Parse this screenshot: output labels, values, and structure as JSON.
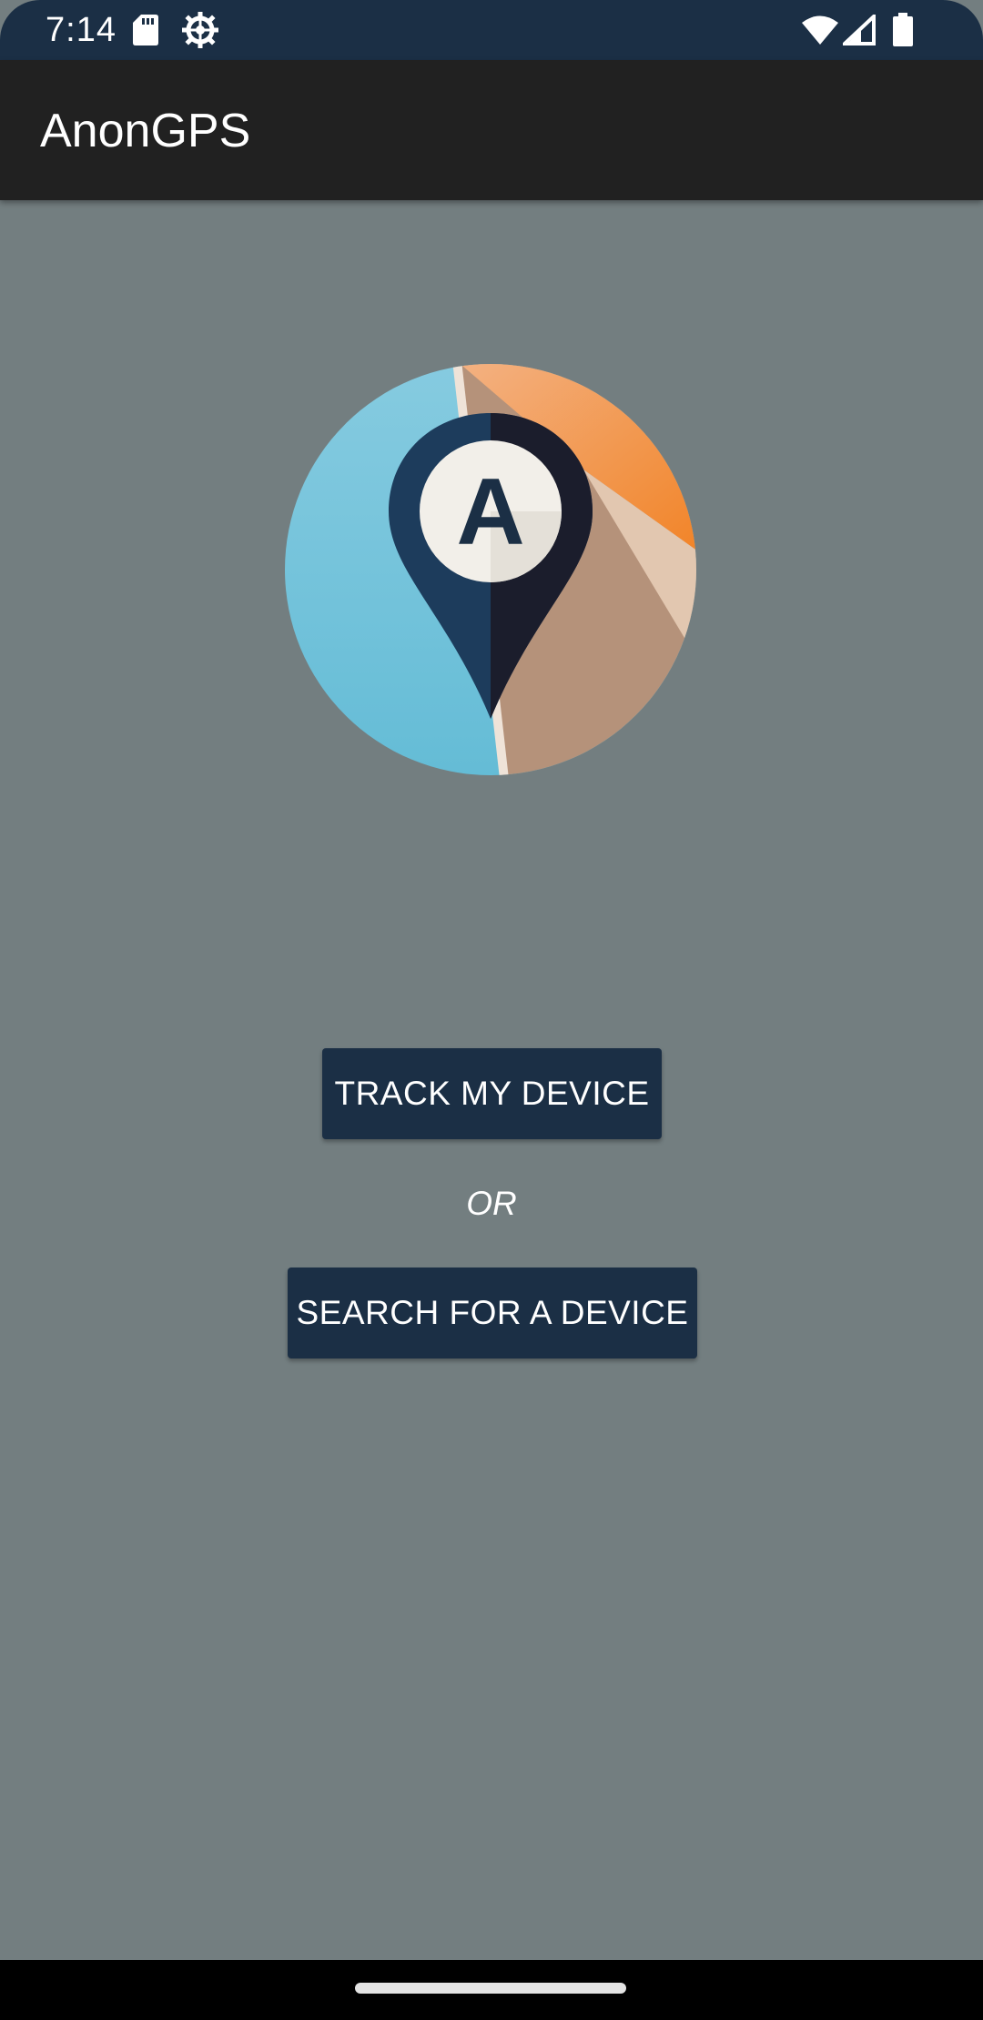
{
  "status_bar": {
    "time": "7:14",
    "icons": [
      "sd-card-icon",
      "gear-icon",
      "wifi-icon",
      "signal-icon",
      "battery-icon"
    ]
  },
  "app_bar": {
    "title": "AnonGPS"
  },
  "main": {
    "logo_letter": "A",
    "track_button_label": "TRACK MY DEVICE",
    "or_label": "OR",
    "search_button_label": "SEARCH FOR A DEVICE"
  },
  "colors": {
    "background": "#737e80",
    "status_bar": "#1b2f45",
    "app_bar": "#212121",
    "button": "#1b2f45",
    "logo_blue": "#6cc3d9",
    "logo_orange": "#f28b2a",
    "logo_tan": "#b58c70",
    "pin_dark": "#1c3552"
  }
}
